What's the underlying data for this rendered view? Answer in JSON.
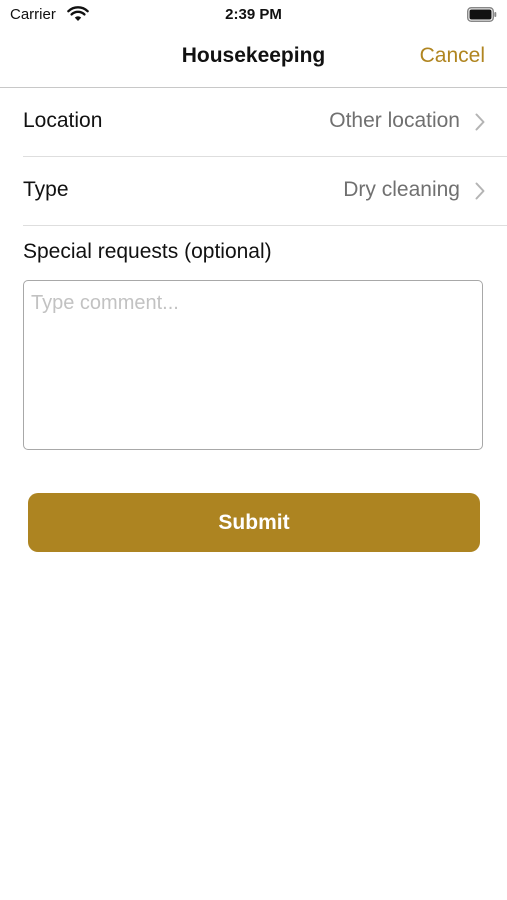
{
  "status_bar": {
    "carrier": "Carrier",
    "time": "2:39 PM",
    "icons": [
      "wifi-icon",
      "battery-icon"
    ]
  },
  "nav": {
    "title": "Housekeeping",
    "cancel_label": "Cancel"
  },
  "form": {
    "location": {
      "label": "Location",
      "value": "Other location"
    },
    "type": {
      "label": "Type",
      "value": "Dry cleaning"
    },
    "special_requests": {
      "label": "Special requests (optional)",
      "placeholder": "Type comment...",
      "value": ""
    },
    "submit_label": "Submit"
  },
  "colors": {
    "accent": "#b08520",
    "button": "#ad8421",
    "secondary_text": "#707070",
    "placeholder": "#c2c2c2",
    "divider": "#dedede"
  }
}
